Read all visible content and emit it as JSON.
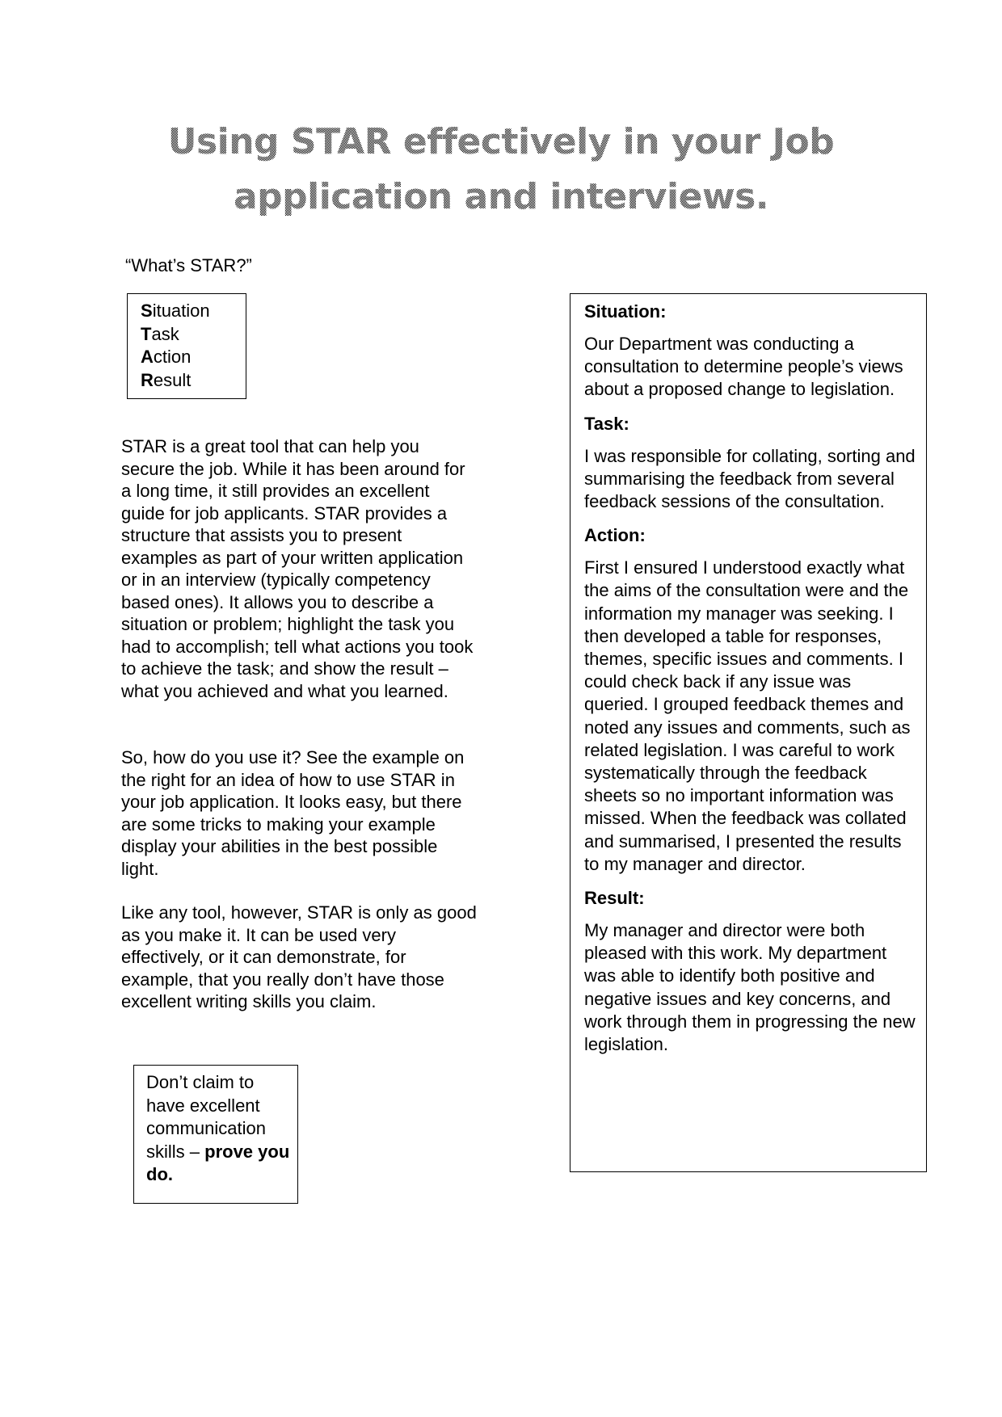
{
  "document": {
    "title_lines": [
      "Using STAR effectively in your Job",
      "application and interviews."
    ],
    "title_color": "#808080",
    "intro_question": "“What’s STAR?”",
    "star_acronym": [
      {
        "letter": "S",
        "rest": "ituation"
      },
      {
        "letter": "T",
        "rest": "ask"
      },
      {
        "letter": "A",
        "rest": "ction"
      },
      {
        "letter": "R",
        "rest": "esult"
      }
    ],
    "paragraphs": [
      "STAR is a great tool that can help you secure the job. While it has been around for a long time, it still provides an excellent guide for job applicants.  STAR provides a structure that assists you to present examples as part of your written application or in an interview (typically competency based ones).  It allows you to describe a situation or problem; highlight the task you had to accomplish; tell what actions you took to achieve the task; and show the result – what you achieved and what you learned.",
      "So, how do you use it? See the example on the right for an idea of how to use STAR in your job application.  It looks easy, but there are some tricks to making your example display your abilities in the best possible light.",
      "Like any tool, however, STAR is only as good as you make it. It can be used very effectively, or it can demonstrate, for example, that you really don’t have those excellent writing skills you claim."
    ],
    "tip": {
      "text": "Don’t claim to have excellent communication skills – ",
      "bold": "prove you do."
    },
    "example": [
      {
        "heading": "Situation:",
        "body": "Our Department was conducting a consultation to determine people’s views about a proposed change to legislation."
      },
      {
        "heading": "Task:",
        "body": "I was responsible for collating, sorting and summarising the feedback from several feedback sessions of the consultation."
      },
      {
        "heading": "Action:",
        "body": "First I ensured I understood exactly what the aims of the consultation were and the information my manager was seeking.  I then developed a table for responses, themes, specific issues and comments.  I could check back if any issue was queried.  I grouped feedback themes and noted any issues and comments, such as related legislation.  I was careful to work systematically through the feedback sheets so no important information was missed.  When the feedback was collated and summarised, I presented the results to my manager and director."
      },
      {
        "heading": "Result:",
        "body": "My manager and director were both pleased with this work.  My department was able to identify both positive and negative issues and key concerns, and work through them in progressing the new legislation."
      }
    ]
  }
}
